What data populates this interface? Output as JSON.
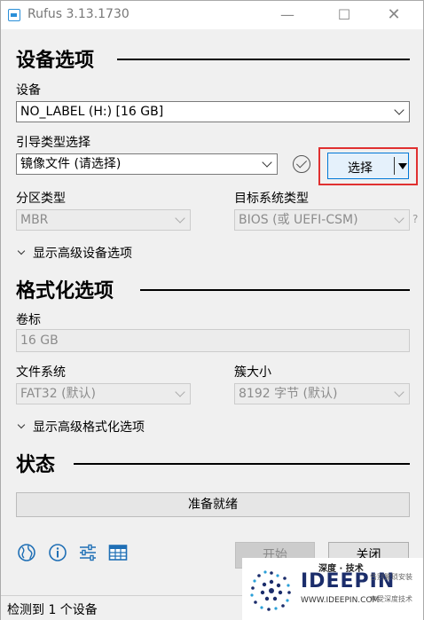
{
  "window": {
    "title": "Rufus 3.13.1730",
    "minimize": "—",
    "maximize": "☐",
    "close": "✕"
  },
  "device_section": {
    "title": "设备选项",
    "device_label": "设备",
    "device_value": "NO_LABEL (H:) [16 GB]",
    "boot_label": "引导类型选择",
    "boot_value": "镜像文件 (请选择)",
    "select_button": "选择",
    "partition_label": "分区类型",
    "partition_value": "MBR",
    "target_label": "目标系统类型",
    "target_value": "BIOS (或 UEFI-CSM)",
    "target_help": "?",
    "advanced_toggle": "显示高级设备选项"
  },
  "format_section": {
    "title": "格式化选项",
    "volume_label": "卷标",
    "volume_value": "16 GB",
    "fs_label": "文件系统",
    "fs_value": "FAT32 (默认)",
    "cluster_label": "簇大小",
    "cluster_value": "8192 字节 (默认)",
    "advanced_toggle": "显示高级格式化选项"
  },
  "status_section": {
    "title": "状态",
    "status_text": "准备就绪"
  },
  "buttons": {
    "start": "开始",
    "close": "关闭"
  },
  "footer": {
    "text": "检测到 1 个设备"
  },
  "watermark": {
    "brand": "IDEEPIN",
    "top": "深度 · 技术",
    "url": "WWW.IDEEPIN.COM",
    "side1": "告别繁琐安装",
    "side2": "享受深度技术"
  },
  "icons": [
    "globe-icon",
    "info-icon",
    "settings-sliders-icon",
    "log-table-icon"
  ],
  "colors": {
    "accent": "#0078d7",
    "highlight": "#e03030",
    "icon_blue": "#1f6fb5"
  }
}
